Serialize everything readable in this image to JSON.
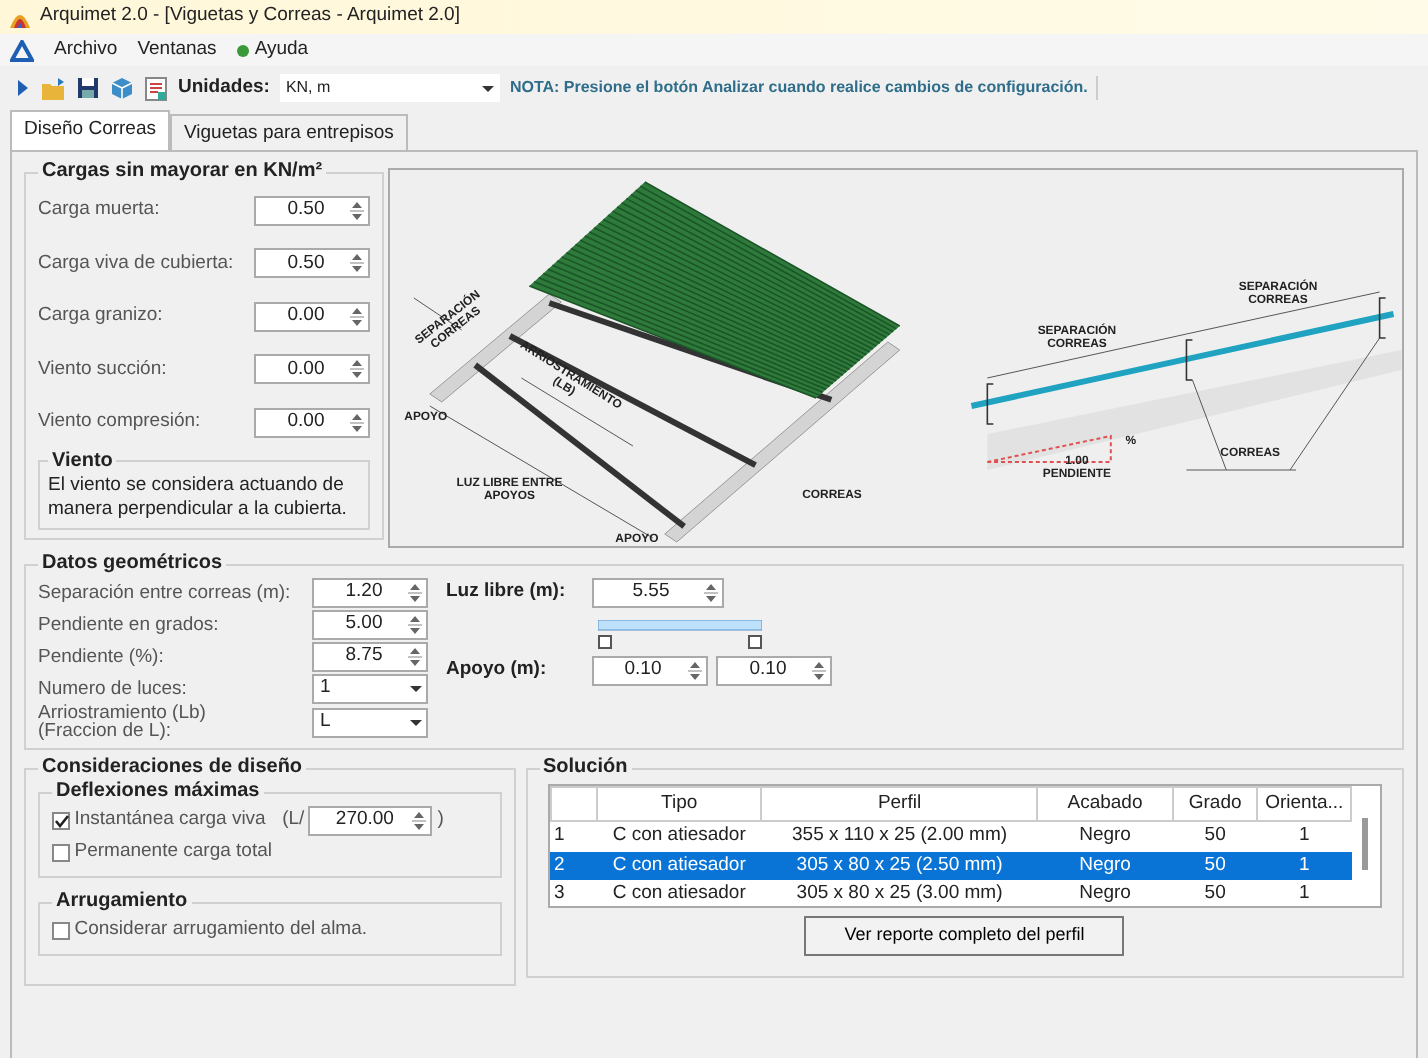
{
  "window": {
    "title": "Arquimet 2.0 - [Viguetas y Correas  - Arquimet 2.0]"
  },
  "menu": [
    {
      "label": "Archivo"
    },
    {
      "label": "Ventanas"
    },
    {
      "label": "Ayuda"
    }
  ],
  "toolbar": {
    "units_label": "Unidades:",
    "units_value": "KN, m",
    "note": "NOTA: Presione el botón Analizar cuando realice cambios de configuración."
  },
  "tabs": [
    {
      "label": "Diseño Correas",
      "selected": true
    },
    {
      "label": "Viguetas para entrepisos",
      "selected": false
    }
  ],
  "loads": {
    "title": "Cargas sin mayorar en KN/m²",
    "fields": [
      {
        "label": "Carga muerta:",
        "value": "0.50"
      },
      {
        "label": "Carga viva de cubierta:",
        "value": "0.50"
      },
      {
        "label": "Carga granizo:",
        "value": "0.00"
      },
      {
        "label": "Viento succión:",
        "value": "0.00"
      },
      {
        "label": "Viento compresión:",
        "value": "0.00"
      }
    ]
  },
  "wind": {
    "title": "Viento",
    "text": "El viento se considera actuando de manera perpendicular a la cubierta."
  },
  "diagram": {
    "labels": [
      {
        "lines": [
          "SEPARACIÓN",
          "CORREAS"
        ]
      },
      {
        "lines": [
          "ARRIOSTRAMIENTO",
          "(LB)"
        ]
      },
      {
        "lines": [
          "APOYO"
        ]
      },
      {
        "lines": [
          "LUZ LIBRE ENTRE",
          "APOYOS"
        ]
      },
      {
        "lines": [
          "CORREAS"
        ]
      },
      {
        "lines": [
          "APOYO"
        ]
      },
      {
        "lines": [
          "SEPARACIÓN",
          "CORREAS"
        ]
      },
      {
        "lines": [
          "SEPARACIÓN",
          "CORREAS"
        ]
      },
      {
        "lines": [
          "%"
        ]
      },
      {
        "lines": [
          "1.00",
          "PENDIENTE"
        ]
      },
      {
        "lines": [
          "CORREAS"
        ]
      }
    ]
  },
  "geometry": {
    "title": "Datos geométricos",
    "fields": [
      {
        "kind": "spin",
        "lines": [
          "Separación entre correas (m):"
        ],
        "value": "1.20"
      },
      {
        "kind": "spin",
        "lines": [
          "Pendiente en grados:"
        ],
        "value": "5.00"
      },
      {
        "kind": "spin",
        "lines": [
          "Pendiente (%):"
        ],
        "value": "8.75"
      },
      {
        "kind": "combo",
        "lines": [
          "Numero de luces:"
        ],
        "value": "1"
      },
      {
        "kind": "combo",
        "lines": [
          "Arriostramiento (Lb)",
          "(Fraccion de L):"
        ],
        "value": "L"
      }
    ],
    "span": {
      "label": "Luz libre (m):",
      "value": "5.55"
    },
    "supports": {
      "label": "Apoyo (m):",
      "values": [
        "0.10",
        "0.10"
      ]
    }
  },
  "design": {
    "title": "Consideraciones de diseño",
    "deflections": {
      "title": "Deflexiones máximas",
      "options": [
        {
          "label": "Instantánea carga viva",
          "checked": true,
          "ratio_prefix": "(L/",
          "ratio": "270.00",
          "ratio_suffix": ")"
        },
        {
          "label": "Permanente carga total",
          "checked": false
        }
      ]
    },
    "wrinkling": {
      "title": "Arrugamiento",
      "options": [
        {
          "label": "Considerar arrugamiento del alma.",
          "checked": false
        }
      ]
    }
  },
  "solution": {
    "title": "Solución",
    "columns": [
      "",
      "Tipo",
      "Perfil",
      "Acabado",
      "Grado",
      "Orienta..."
    ],
    "rows": [
      {
        "cells": [
          "1",
          "C con atiesador",
          "355 x 110 x 25 (2.00 mm)",
          "Negro",
          "50",
          "1"
        ],
        "selected": false
      },
      {
        "cells": [
          "2",
          "C con atiesador",
          "305 x 80 x 25 (2.50 mm)",
          "Negro",
          "50",
          "1"
        ],
        "selected": true
      },
      {
        "cells": [
          "3",
          "C con atiesador",
          "305 x 80 x 25 (3.00 mm)",
          "Negro",
          "50",
          "1"
        ],
        "selected": false
      }
    ],
    "button": "Ver reporte completo del perfil"
  }
}
